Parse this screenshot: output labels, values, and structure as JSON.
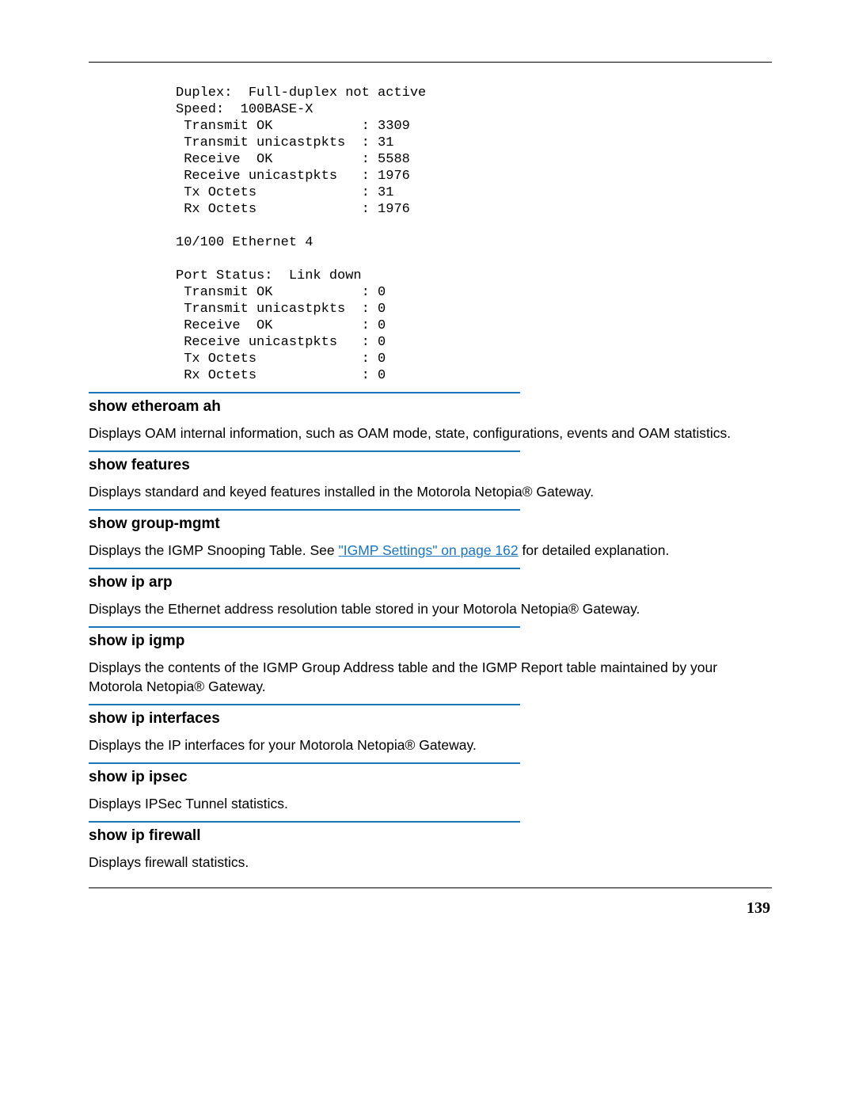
{
  "code_block": "Duplex:  Full-duplex not active\nSpeed:  100BASE-X\n Transmit OK           : 3309\n Transmit unicastpkts  : 31\n Receive  OK           : 5588\n Receive unicastpkts   : 1976\n Tx Octets             : 31\n Rx Octets             : 1976\n\n10/100 Ethernet 4\n\nPort Status:  Link down\n Transmit OK           : 0\n Transmit unicastpkts  : 0\n Receive  OK           : 0\n Receive unicastpkts   : 0\n Tx Octets             : 0\n Rx Octets             : 0",
  "sections": {
    "etheroam": {
      "heading": "show etheroam ah",
      "desc": "Displays OAM internal information, such as OAM mode, state, configurations, events and OAM statistics."
    },
    "features": {
      "heading": "show features",
      "desc": "Displays standard and keyed features installed in the Motorola Netopia® Gateway."
    },
    "groupmgmt": {
      "heading": "show group-mgmt",
      "desc_pre": "Displays the IGMP Snooping Table. See ",
      "link": "\"IGMP Settings\" on page 162",
      "desc_post": " for detailed explanation."
    },
    "iparp": {
      "heading": "show ip arp",
      "desc": "Displays the Ethernet address resolution table stored in your Motorola Netopia® Gateway."
    },
    "ipigmp": {
      "heading": "show ip igmp",
      "desc": "Displays the contents of the IGMP Group Address table and the IGMP Report table maintained by your Motorola Netopia® Gateway."
    },
    "ipinterfaces": {
      "heading": "show ip interfaces",
      "desc": "Displays the IP interfaces for your Motorola Netopia® Gateway."
    },
    "ipipsec": {
      "heading": "show ip ipsec",
      "desc": "Displays IPSec Tunnel statistics."
    },
    "ipfirewall": {
      "heading": "show ip firewall",
      "desc": "Displays firewall statistics."
    }
  },
  "page_number": "139"
}
